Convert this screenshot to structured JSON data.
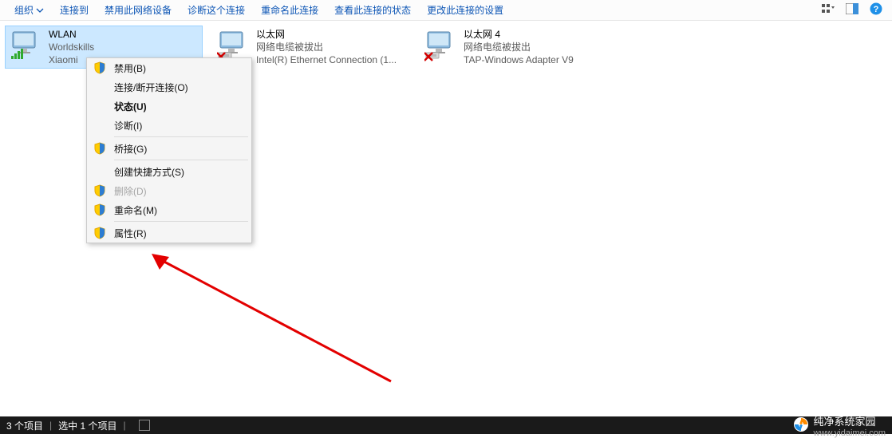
{
  "toolbar": {
    "items": [
      {
        "label": "组织",
        "dropdown": true
      },
      {
        "label": "连接到"
      },
      {
        "label": "禁用此网络设备"
      },
      {
        "label": "诊断这个连接"
      },
      {
        "label": "重命名此连接"
      },
      {
        "label": "查看此连接的状态"
      },
      {
        "label": "更改此连接的设置"
      }
    ]
  },
  "connections": [
    {
      "name": "WLAN",
      "status": "Worldskills",
      "device": "Xiaomi",
      "selected": true,
      "signal": true
    },
    {
      "name": "以太网",
      "status": "网络电缆被拔出",
      "device": "Intel(R) Ethernet Connection (1...",
      "selected": false,
      "disconnected": true
    },
    {
      "name": "以太网 4",
      "status": "网络电缆被拔出",
      "device": "TAP-Windows Adapter V9",
      "selected": false,
      "disconnected": true
    }
  ],
  "context_menu": {
    "groups": [
      [
        {
          "label": "禁用(B)",
          "shield": true,
          "disabled": false
        },
        {
          "label": "连接/断开连接(O)",
          "shield": false,
          "disabled": false
        },
        {
          "label": "状态(U)",
          "shield": false,
          "disabled": false,
          "bold": true
        },
        {
          "label": "诊断(I)",
          "shield": false,
          "disabled": false
        }
      ],
      [
        {
          "label": "桥接(G)",
          "shield": true,
          "disabled": false
        }
      ],
      [
        {
          "label": "创建快捷方式(S)",
          "shield": false,
          "disabled": false
        },
        {
          "label": "删除(D)",
          "shield": true,
          "disabled": true
        },
        {
          "label": "重命名(M)",
          "shield": true,
          "disabled": false
        }
      ],
      [
        {
          "label": "属性(R)",
          "shield": true,
          "disabled": false
        }
      ]
    ]
  },
  "status_bar": {
    "count_text": "3 个项目",
    "selection_text": "选中 1 个项目",
    "brand_main": "纯净系统家园",
    "brand_sub": "www.yidaimei.com"
  }
}
